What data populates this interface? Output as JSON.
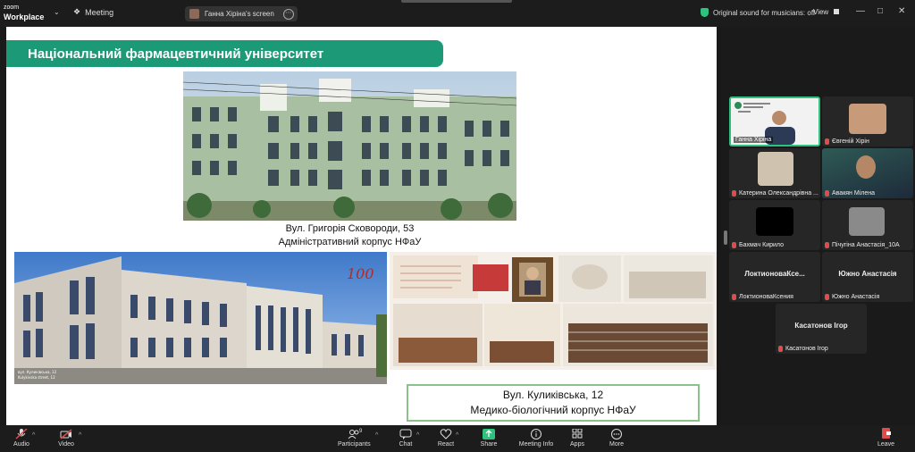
{
  "app": {
    "logo_line1": "zoom",
    "logo_line2": "Workplace",
    "meeting_label": "Meeting"
  },
  "share_pill": {
    "label": "Ганна Хіріна's screen"
  },
  "top_right": {
    "sound": "Original sound for musicians: off",
    "view": "View"
  },
  "slide": {
    "title": "Національний фармацевтичний університет",
    "caption1_line1": "Вул. Григорія Сковороди, 53",
    "caption1_line2": "Адміністративний корпус НФаУ",
    "caption2_line1": "Вул. Куликівська, 12",
    "caption2_line2": "Медико-біологічний корпус НФаУ",
    "photo_badge": "100",
    "photo_small1": "вул. Куликівська, 12",
    "photo_small2": "Kulykivska street, 12"
  },
  "participants": [
    {
      "name": "Ганна Хіріна",
      "muted": false,
      "active": true
    },
    {
      "name": "Євгеній Хірін",
      "muted": true
    },
    {
      "name": "Катерина Олександрівна ...",
      "muted": true
    },
    {
      "name": "Авакян Мілена",
      "muted": true
    },
    {
      "name": "Бахмач Кирило",
      "muted": true
    },
    {
      "name": "Пічугіна Анастасія_10А",
      "muted": true
    },
    {
      "name": "ЛоктионоваКсения",
      "display": "ЛоктионоваКсе...",
      "muted": true
    },
    {
      "name": "Южно Анастасія",
      "display": "Южно Анастасія",
      "muted": true
    },
    {
      "name": "Касатонов Ігор",
      "display": "Касатонов Ігор",
      "muted": true
    }
  ],
  "toolbar": {
    "audio": "Audio",
    "video": "Video",
    "participants": "Participants",
    "participants_count": "9",
    "chat": "Chat",
    "react": "React",
    "share": "Share",
    "meeting_info": "Meeting Info",
    "apps": "Apps",
    "more": "More",
    "leave": "Leave"
  },
  "colors": {
    "accent_green": "#1c9a77",
    "share_green": "#2ec27e",
    "leave_red": "#e04b4b"
  }
}
